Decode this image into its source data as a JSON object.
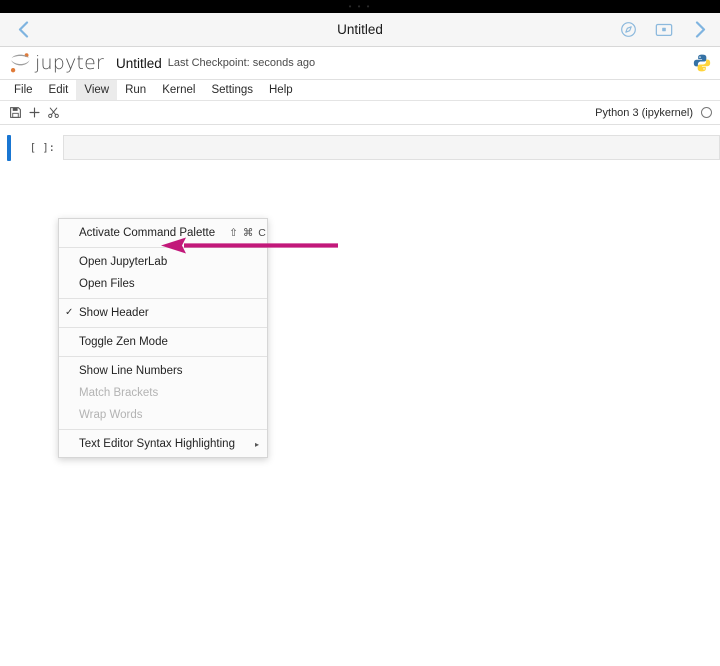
{
  "browser": {
    "title": "Untitled",
    "back_icon": "chevron-left-icon",
    "forward_icon": "chevron-right-icon",
    "compass_icon": "compass-icon",
    "tabs_icon": "tab-overview-icon"
  },
  "jupyter": {
    "logo_text": "jupyter",
    "notebook_title": "Untitled",
    "checkpoint": "Last Checkpoint: seconds ago",
    "python_logo": "python-logo-icon"
  },
  "menubar": {
    "items": [
      {
        "label": "File",
        "active": false
      },
      {
        "label": "Edit",
        "active": false
      },
      {
        "label": "View",
        "active": true
      },
      {
        "label": "Run",
        "active": false
      },
      {
        "label": "Kernel",
        "active": false
      },
      {
        "label": "Settings",
        "active": false
      },
      {
        "label": "Help",
        "active": false
      }
    ]
  },
  "toolbar": {
    "save_icon": "save-icon",
    "add_icon": "plus-icon",
    "cut_icon": "scissors-icon",
    "kernel_label": "Python 3 (ipykernel)",
    "kernel_status_icon": "kernel-idle-circle-icon"
  },
  "view_menu": {
    "items": [
      {
        "label": "Activate Command Palette",
        "shortcut": "⇧ ⌘ C",
        "checked": false,
        "disabled": false,
        "submenu": false
      },
      {
        "separator": true
      },
      {
        "label": "Open JupyterLab",
        "shortcut": "",
        "checked": false,
        "disabled": false,
        "submenu": false
      },
      {
        "label": "Open Files",
        "shortcut": "",
        "checked": false,
        "disabled": false,
        "submenu": false
      },
      {
        "separator": true
      },
      {
        "label": "Show Header",
        "shortcut": "",
        "checked": true,
        "disabled": false,
        "submenu": false
      },
      {
        "separator": true
      },
      {
        "label": "Toggle Zen Mode",
        "shortcut": "",
        "checked": false,
        "disabled": false,
        "submenu": false
      },
      {
        "separator": true
      },
      {
        "label": "Show Line Numbers",
        "shortcut": "",
        "checked": false,
        "disabled": false,
        "submenu": false
      },
      {
        "label": "Match Brackets",
        "shortcut": "",
        "checked": false,
        "disabled": true,
        "submenu": false
      },
      {
        "label": "Wrap Words",
        "shortcut": "",
        "checked": false,
        "disabled": true,
        "submenu": false
      },
      {
        "separator": true
      },
      {
        "label": "Text Editor Syntax Highlighting",
        "shortcut": "",
        "checked": false,
        "disabled": false,
        "submenu": true
      }
    ],
    "check_glyph": "✓",
    "submenu_glyph": "▸"
  },
  "notebook": {
    "cell_prompt": "[ ]:",
    "cell_value": ""
  },
  "annotation": {
    "arrow_color": "#c2187a",
    "arrow_direction": "left"
  },
  "colors": {
    "accent_blue": "#1976d2",
    "safari_tint": "#7fb4e0",
    "menu_active_bg": "#ebebeb",
    "arrow_magenta": "#c2187a"
  }
}
